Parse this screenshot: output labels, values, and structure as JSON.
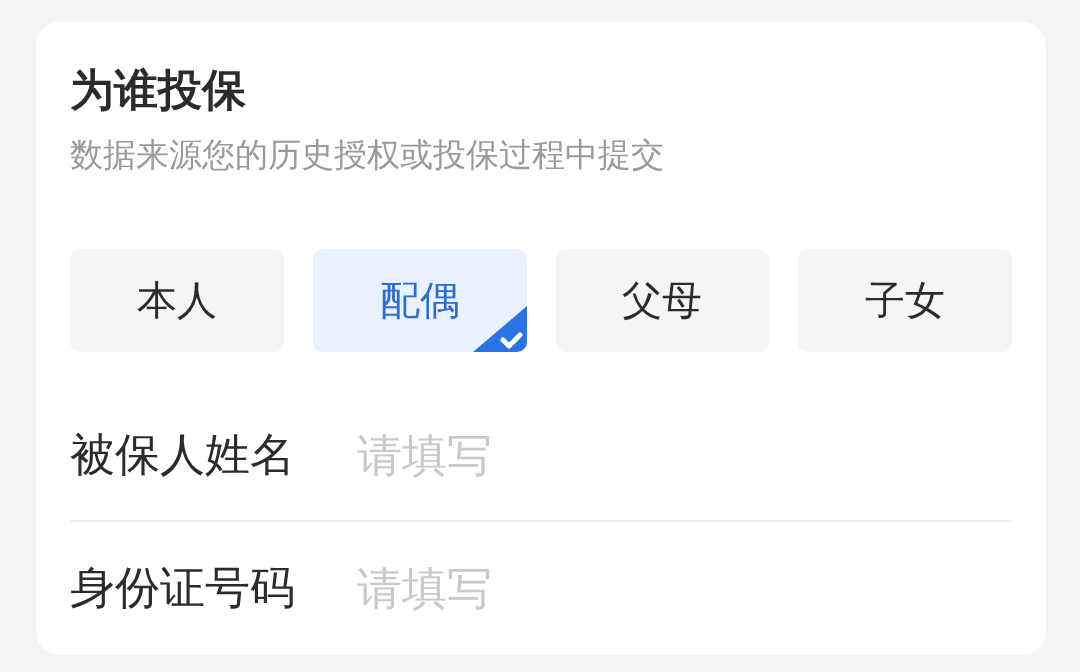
{
  "card": {
    "title": "为谁投保",
    "subtitle": "数据来源您的历史授权或投保过程中提交"
  },
  "insured_options": [
    {
      "label": "本人",
      "selected": false
    },
    {
      "label": "配偶",
      "selected": true
    },
    {
      "label": "父母",
      "selected": false
    },
    {
      "label": "子女",
      "selected": false
    }
  ],
  "fields": [
    {
      "label": "被保人姓名",
      "placeholder": "请填写"
    },
    {
      "label": "身份证号码",
      "placeholder": "请填写"
    }
  ]
}
